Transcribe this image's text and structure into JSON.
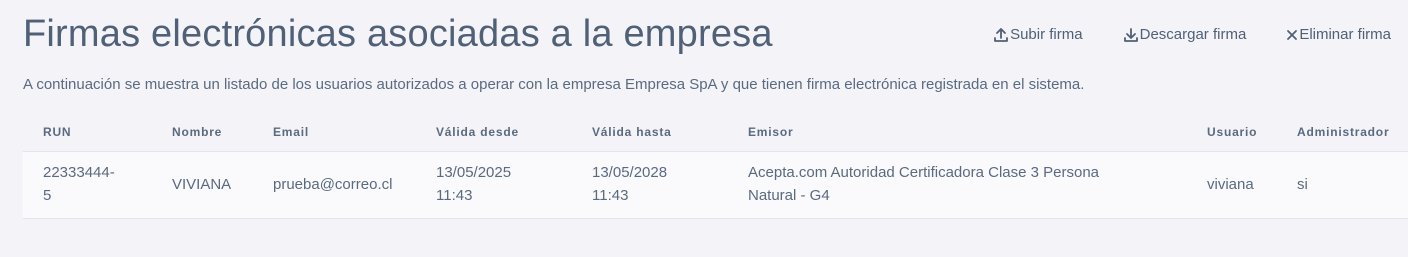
{
  "page": {
    "title": "Firmas electrónicas asociadas a la empresa",
    "subtitle": "A continuación se muestra un listado de los usuarios autorizados a operar con la empresa Empresa SpA y que tienen firma electrónica registrada en el sistema."
  },
  "actions": {
    "upload": {
      "label": "Subir firma",
      "icon": "upload-icon"
    },
    "download": {
      "label": "Descargar firma",
      "icon": "download-icon"
    },
    "delete": {
      "label": "Eliminar firma",
      "icon": "close-icon"
    }
  },
  "table": {
    "headers": [
      "RUN",
      "Nombre",
      "Email",
      "Válida desde",
      "Válida hasta",
      "Emisor",
      "Usuario",
      "Administrador"
    ],
    "rows": [
      {
        "run_1": "22333444-",
        "run_2": "5",
        "nombre": "VIVIANA",
        "email": "prueba@correo.cl",
        "desde_1": "13/05/2025",
        "desde_2": "11:43",
        "hasta_1": "13/05/2028",
        "hasta_2": "11:43",
        "emisor_1": "Acepta.com Autoridad Certificadora Clase 3 Persona",
        "emisor_2": "Natural - G4",
        "usuario": "viviana",
        "administrador": "si"
      }
    ]
  },
  "colors": {
    "background": "#f4f4f8",
    "title": "#4f6077",
    "text": "#5a6a80",
    "row_background": "#fafafc",
    "divider": "#e2e5ec"
  }
}
